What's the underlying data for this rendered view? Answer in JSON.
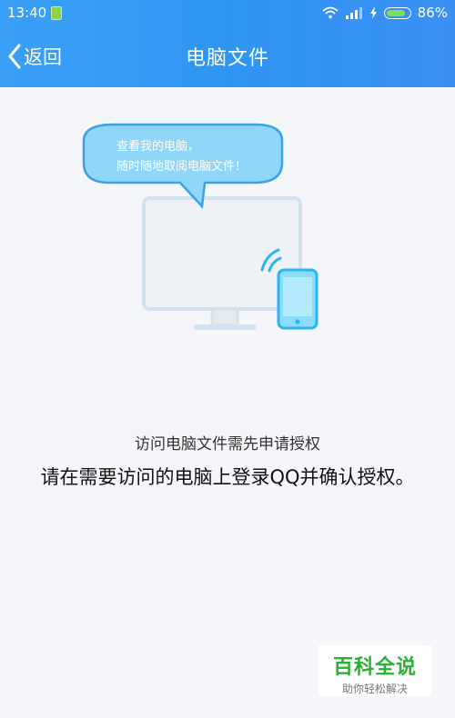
{
  "status_bar": {
    "time": "13:40",
    "battery_percent": "86%",
    "battery_level": 0.86
  },
  "header": {
    "back_label": "返回",
    "title": "电脑文件"
  },
  "illustration": {
    "bubble_line1": "查看我的电脑，",
    "bubble_line2": "随时随地取阅电脑文件！"
  },
  "main": {
    "hint_small": "访问电脑文件需先申请授权",
    "hint_big": "请在需要访问的电脑上登录QQ并确认授权。"
  },
  "watermark": {
    "title": "百科全说",
    "subtitle": "助你轻松解决"
  },
  "colors": {
    "header": "#3a98f5",
    "bubble": "#8fd6f8",
    "monitor_frame": "#d7e7f2",
    "phone": "#2cb3f4",
    "watermark_green": "#29b032"
  }
}
